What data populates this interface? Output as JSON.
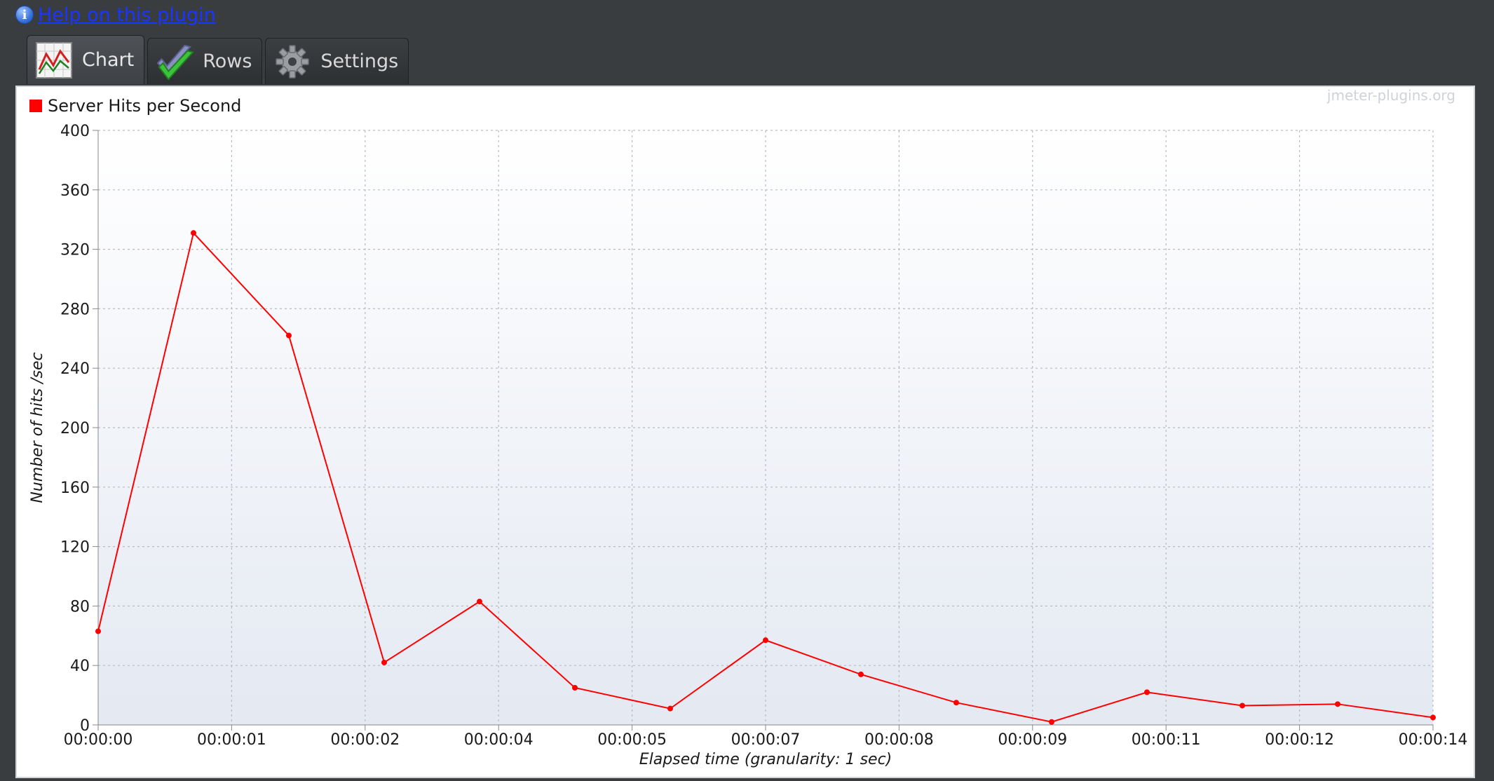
{
  "help": {
    "link_text": "Help on this plugin"
  },
  "tabs": [
    {
      "label": "Chart",
      "icon": "line-chart-icon",
      "active": true
    },
    {
      "label": "Rows",
      "icon": "checkmark-icon",
      "active": false
    },
    {
      "label": "Settings",
      "icon": "gear-icon",
      "active": false
    }
  ],
  "watermark": "jmeter-plugins.org",
  "colors": {
    "series": "#ff0000",
    "background": "#3a3d40"
  },
  "chart_data": {
    "type": "line",
    "title": "",
    "xlabel": "Elapsed time (granularity: 1 sec)",
    "ylabel": "Number of hits /sec",
    "ylim": [
      0,
      400
    ],
    "yticks": [
      "0",
      "40",
      "80",
      "120",
      "160",
      "200",
      "240",
      "280",
      "320",
      "360",
      "400"
    ],
    "xticks": [
      "00:00:00",
      "00:00:01",
      "00:00:02",
      "00:00:04",
      "00:00:05",
      "00:00:07",
      "00:00:08",
      "00:00:09",
      "00:00:11",
      "00:00:12",
      "00:00:14"
    ],
    "grid": true,
    "legend_position": "top-left",
    "series": [
      {
        "name": "Server Hits per Second",
        "color": "#ff0000",
        "x": [
          0,
          1,
          2,
          3,
          4,
          5,
          6,
          7,
          8,
          9,
          10,
          11,
          12,
          13,
          14
        ],
        "values": [
          63,
          331,
          262,
          42,
          83,
          25,
          11,
          57,
          34,
          15,
          2,
          22,
          13,
          14,
          5
        ]
      }
    ]
  }
}
